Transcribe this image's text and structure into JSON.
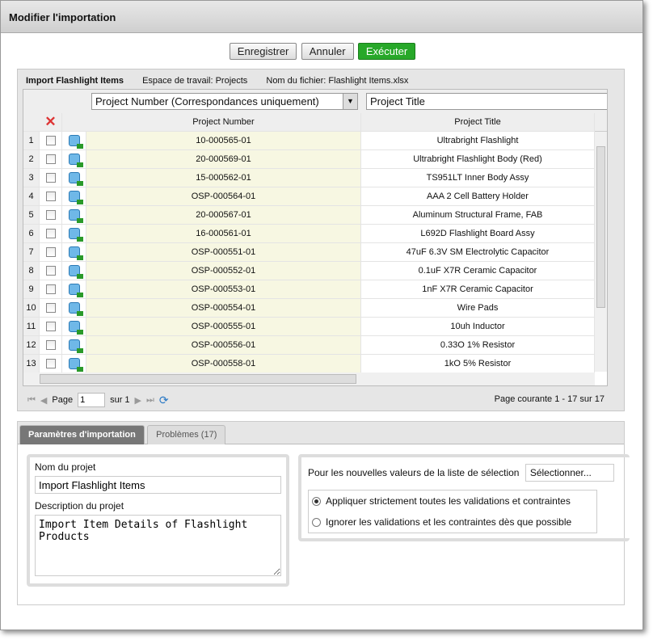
{
  "window": {
    "title": "Modifier l'importation"
  },
  "toolbar": {
    "save": "Enregistrer",
    "cancel": "Annuler",
    "run": "Exécuter"
  },
  "info": {
    "name": "Import Flashlight Items",
    "workspace": "Espace de travail: Projects",
    "file": "Nom du fichier: Flashlight Items.xlsx"
  },
  "grid": {
    "mapping": [
      "Project Number (Correspondances uniquement)",
      "Project Title"
    ],
    "headers": [
      "Project Number",
      "Project Title"
    ],
    "rows": [
      {
        "n": "1",
        "num": "10-000565-01",
        "title": "Ultrabright Flashlight"
      },
      {
        "n": "2",
        "num": "20-000569-01",
        "title": "Ultrabright Flashlight Body (Red)"
      },
      {
        "n": "3",
        "num": "15-000562-01",
        "title": "TS951LT Inner Body Assy"
      },
      {
        "n": "4",
        "num": "OSP-000564-01",
        "title": "AAA 2 Cell Battery Holder"
      },
      {
        "n": "5",
        "num": "20-000567-01",
        "title": "Aluminum Structural Frame, FAB"
      },
      {
        "n": "6",
        "num": "16-000561-01",
        "title": "L692D Flashlight Board Assy"
      },
      {
        "n": "7",
        "num": "OSP-000551-01",
        "title": "47uF 6.3V SM Electrolytic Capacitor"
      },
      {
        "n": "8",
        "num": "OSP-000552-01",
        "title": "0.1uF X7R Ceramic Capacitor"
      },
      {
        "n": "9",
        "num": "OSP-000553-01",
        "title": "1nF X7R Ceramic Capacitor"
      },
      {
        "n": "10",
        "num": "OSP-000554-01",
        "title": "Wire Pads"
      },
      {
        "n": "11",
        "num": "OSP-000555-01",
        "title": "10uh Inductor"
      },
      {
        "n": "12",
        "num": "OSP-000556-01",
        "title": "0.33O 1% Resistor"
      },
      {
        "n": "13",
        "num": "OSP-000558-01",
        "title": "1kO 5% Resistor"
      }
    ]
  },
  "pager": {
    "page_label": "Page",
    "page": "1",
    "of": "sur 1",
    "status": "Page courante 1 - 17 sur 17"
  },
  "tabs": [
    "Paramètres d'importation",
    "Problèmes (17)"
  ],
  "settings": {
    "name_label": "Nom du projet",
    "name_value": "Import Flashlight Items",
    "desc_label": "Description du projet",
    "desc_value": "Import Item Details of Flashlight Products",
    "picklist_label": "Pour les nouvelles valeurs de la liste de sélection",
    "picklist_value": "Sélectionner...",
    "radio1": "Appliquer strictement toutes les validations et contraintes",
    "radio2": "Ignorer les validations et les contraintes dès que possible"
  }
}
